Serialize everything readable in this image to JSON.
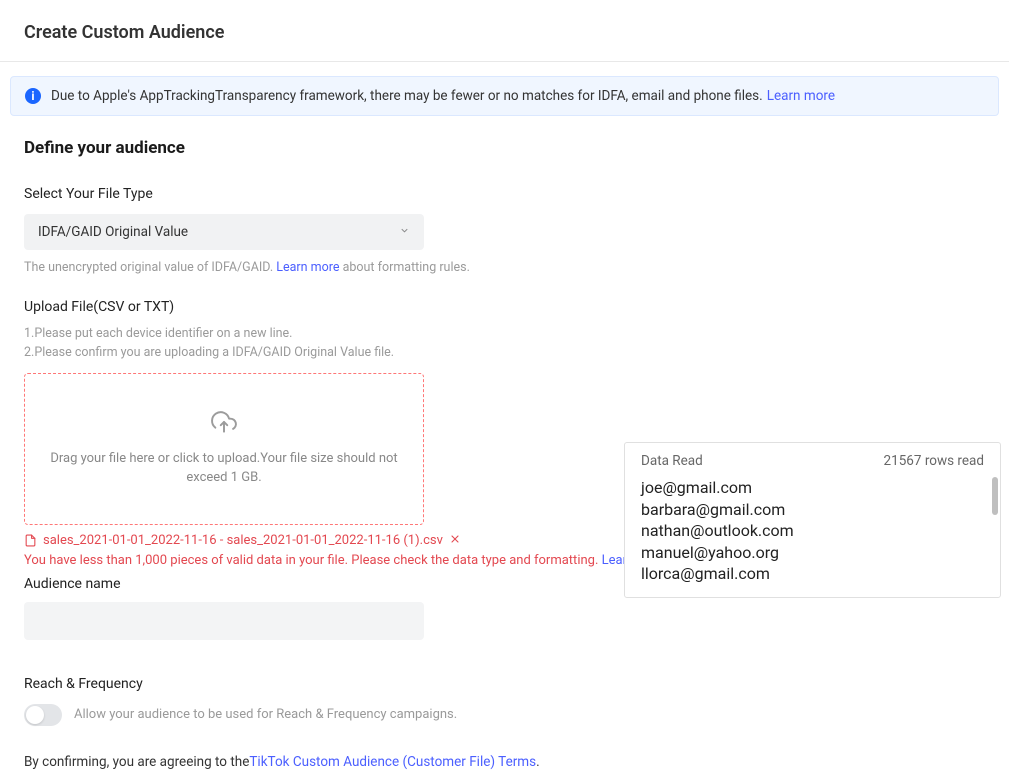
{
  "page": {
    "title": "Create Custom Audience"
  },
  "banner": {
    "text": "Due to Apple's AppTrackingTransparency framework, there may be fewer or no matches for IDFA, email and phone files.",
    "learn_more": "Learn more"
  },
  "section": {
    "title": "Define your audience"
  },
  "file_type": {
    "label": "Select Your File Type",
    "selected": "IDFA/GAID Original Value",
    "hint_prefix": "The unencrypted original value of IDFA/GAID. ",
    "hint_link": "Learn more",
    "hint_suffix": " about formatting rules."
  },
  "upload": {
    "label": "Upload File(CSV or TXT)",
    "hint1": "1.Please put each device identifier on a new line.",
    "hint2": "2.Please confirm you are uploading a IDFA/GAID Original Value file.",
    "dropzone_text": "Drag your file here or click to upload.Your file size should not exceed 1 GB.",
    "file_name": "sales_2021-01-01_2022-11-16 - sales_2021-01-01_2022-11-16 (1).csv",
    "error_text": "You have less than 1,000 pieces of valid data in your file. Please check the data type and formatting. ",
    "error_link": "Learn more",
    "error_period": "."
  },
  "audience_name": {
    "label": "Audience name",
    "value": ""
  },
  "reach": {
    "label": "Reach & Frequency",
    "toggle_text": "Allow your audience to be used for Reach & Frequency campaigns.",
    "toggled": false
  },
  "confirm": {
    "prefix": "By confirming, you are agreeing to the",
    "link": "TikTok Custom Audience (Customer File) Terms",
    "suffix": "."
  },
  "data_read": {
    "title": "Data Read",
    "rows_text": "21567 rows read",
    "rows": [
      "joe@gmail.com",
      "barbara@gmail.com",
      "nathan@outlook.com",
      "manuel@yahoo.org",
      "llorca@gmail.com"
    ]
  }
}
